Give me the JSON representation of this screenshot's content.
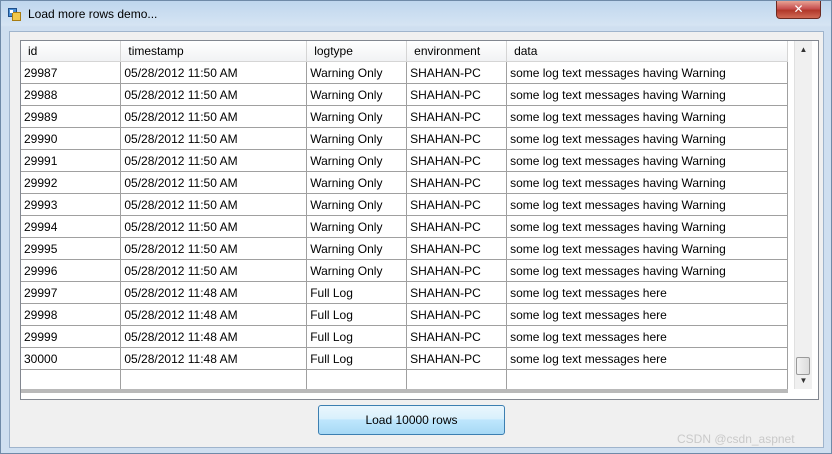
{
  "window": {
    "title": "Load more rows demo...",
    "close_glyph": "✕"
  },
  "grid": {
    "columns": [
      "id",
      "timestamp",
      "logtype",
      "environment",
      "data"
    ],
    "rows": [
      [
        "29987",
        "05/28/2012 11:50 AM",
        "Warning Only",
        "SHAHAN-PC",
        "some log text messages having Warning"
      ],
      [
        "29988",
        "05/28/2012 11:50 AM",
        "Warning Only",
        "SHAHAN-PC",
        "some log text messages having Warning"
      ],
      [
        "29989",
        "05/28/2012 11:50 AM",
        "Warning Only",
        "SHAHAN-PC",
        "some log text messages having Warning"
      ],
      [
        "29990",
        "05/28/2012 11:50 AM",
        "Warning Only",
        "SHAHAN-PC",
        "some log text messages having Warning"
      ],
      [
        "29991",
        "05/28/2012 11:50 AM",
        "Warning Only",
        "SHAHAN-PC",
        "some log text messages having Warning"
      ],
      [
        "29992",
        "05/28/2012 11:50 AM",
        "Warning Only",
        "SHAHAN-PC",
        "some log text messages having Warning"
      ],
      [
        "29993",
        "05/28/2012 11:50 AM",
        "Warning Only",
        "SHAHAN-PC",
        "some log text messages having Warning"
      ],
      [
        "29994",
        "05/28/2012 11:50 AM",
        "Warning Only",
        "SHAHAN-PC",
        "some log text messages having Warning"
      ],
      [
        "29995",
        "05/28/2012 11:50 AM",
        "Warning Only",
        "SHAHAN-PC",
        "some log text messages having Warning"
      ],
      [
        "29996",
        "05/28/2012 11:50 AM",
        "Warning Only",
        "SHAHAN-PC",
        "some log text messages having Warning"
      ],
      [
        "29997",
        "05/28/2012 11:48 AM",
        "Full Log",
        "SHAHAN-PC",
        "some log text messages here"
      ],
      [
        "29998",
        "05/28/2012 11:48 AM",
        "Full Log",
        "SHAHAN-PC",
        "some log text messages here"
      ],
      [
        "29999",
        "05/28/2012 11:48 AM",
        "Full Log",
        "SHAHAN-PC",
        "some log text messages here"
      ],
      [
        "30000",
        "05/28/2012 11:48 AM",
        "Full Log",
        "SHAHAN-PC",
        "some log text messages here"
      ],
      [
        "",
        "",
        "",
        "",
        ""
      ]
    ],
    "scroll_position": 0.97
  },
  "load_button": {
    "label": "Load 10000 rows"
  },
  "watermark": "CSDN @csdn_aspnet",
  "colors": {
    "close": "#c75050",
    "button_border": "#3c7fb1",
    "grid_line": "#a0a0a0"
  }
}
